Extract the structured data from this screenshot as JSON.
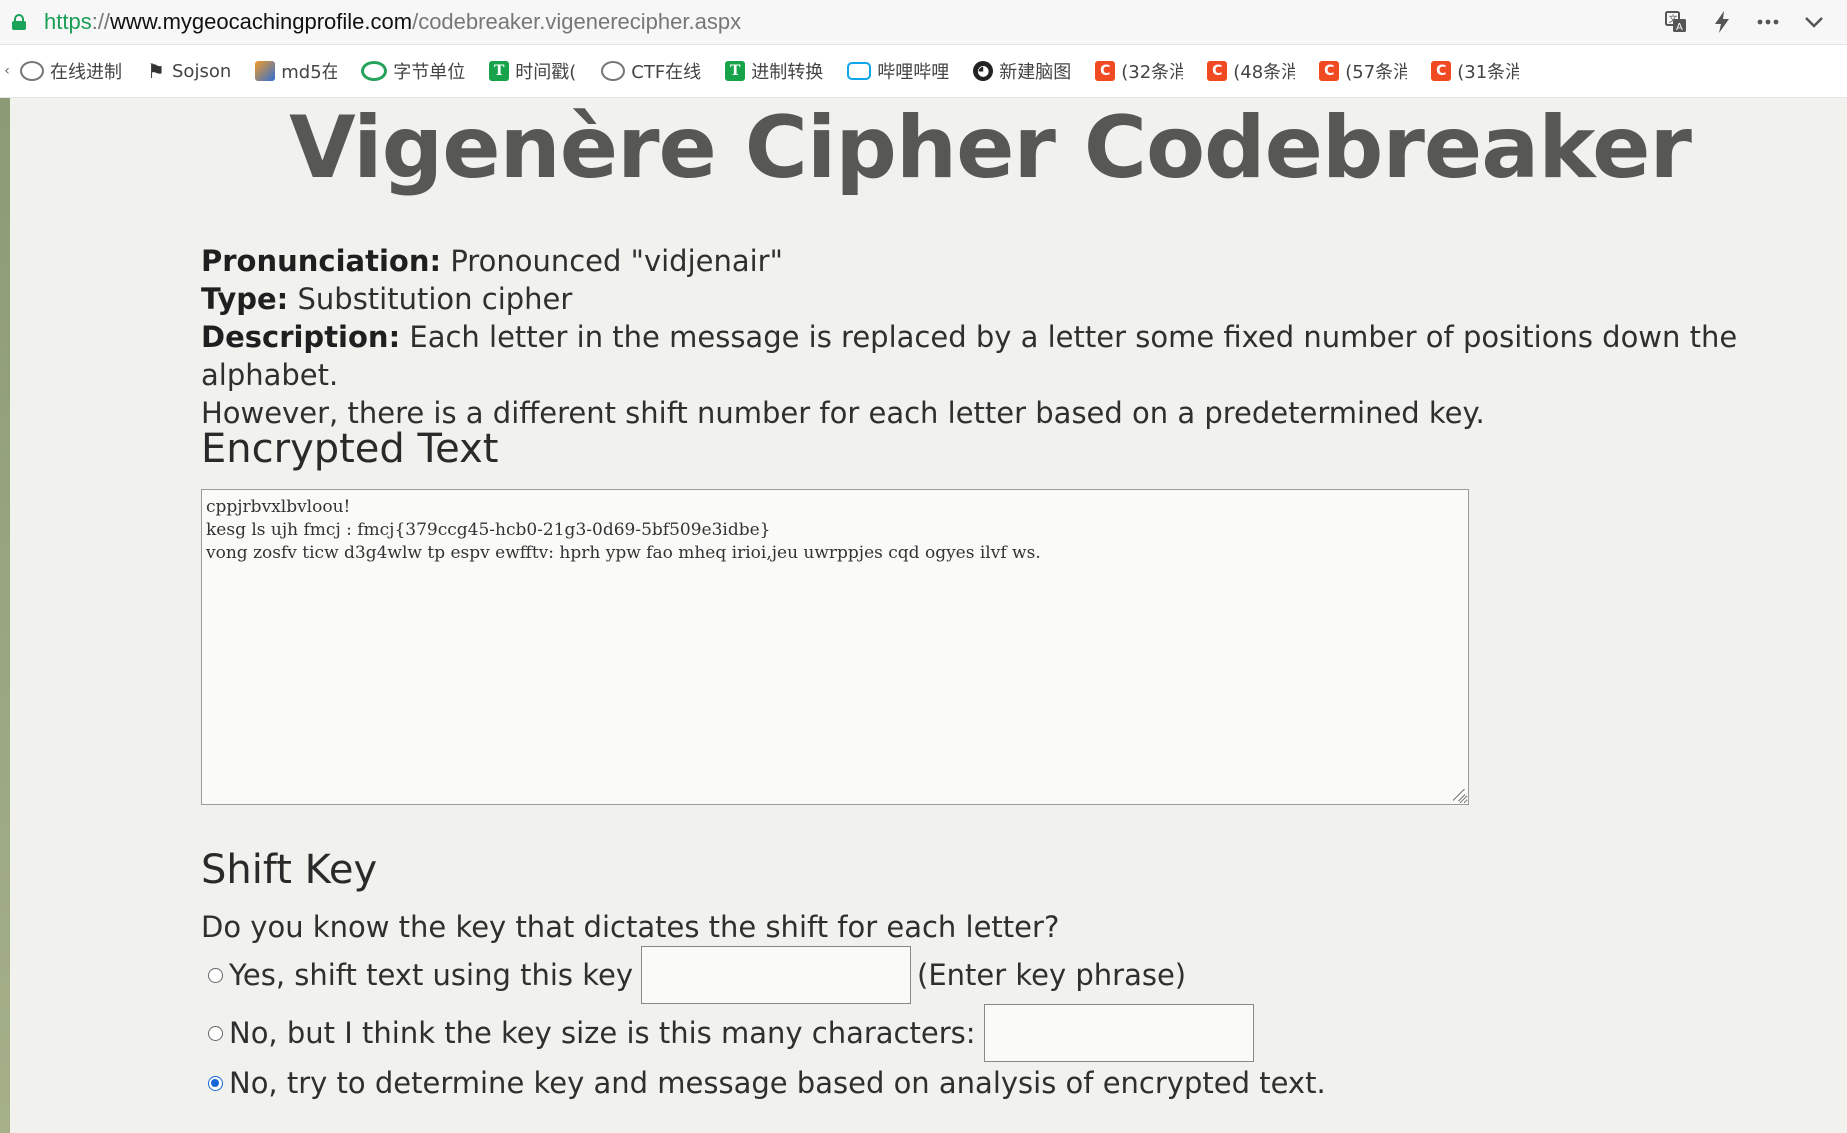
{
  "address_bar": {
    "scheme": "https",
    "separator": "://",
    "host": "www.mygeocachingprofile.com",
    "path": "/codebreaker.vigenerecipher.aspx",
    "icons": [
      "translate-icon",
      "lightning-icon",
      "more-icon",
      "chevron-down-icon"
    ]
  },
  "bookmarks": [
    {
      "label": "在线进制",
      "icon": "globe-icon"
    },
    {
      "label": "Sojson",
      "icon": "flag-icon"
    },
    {
      "label": "md5在",
      "icon": "md5-icon"
    },
    {
      "label": "字节单位",
      "icon": "circle-icon"
    },
    {
      "label": "时间戳(",
      "icon": "t-icon"
    },
    {
      "label": "CTF在线",
      "icon": "globe-icon"
    },
    {
      "label": "进制转换",
      "icon": "t-icon"
    },
    {
      "label": "哔哩哔哩",
      "icon": "bilibili-icon"
    },
    {
      "label": "新建脑图",
      "icon": "owl-icon"
    },
    {
      "label": "(32条消",
      "icon": "c-icon"
    },
    {
      "label": "(48条消",
      "icon": "c-icon"
    },
    {
      "label": "(57条消",
      "icon": "c-icon"
    },
    {
      "label": "(31条消",
      "icon": "c-icon"
    }
  ],
  "page": {
    "title": "Vigenère Cipher Codebreaker",
    "pronunciation_label": "Pronunciation:",
    "pronunciation_value": "Pronounced \"vidjenair\"",
    "type_label": "Type:",
    "type_value": "Substitution cipher",
    "description_label": "Description:",
    "description_line1": "Each letter in the message is replaced by a letter some fixed number of positions down the alphabet.",
    "description_line2": "However, there is a different shift number for each letter based on a predetermined key.",
    "encrypted_heading": "Encrypted Text",
    "encrypted_text": "cppjrbvxlbvloou!\nkesg ls ujh fmcj : fmcj{379ccg45-hcb0-21g3-0d69-5bf509e3idbe}\nvong zosfv ticw d3g4wlw tp espv ewfftv: hprh ypw fao mheq irioi,jeu uwrppjes cqd ogyes ilvf ws.",
    "shift_heading": "Shift Key",
    "shift_question": "Do you know the key that dictates the shift for each letter?",
    "option1_label": "Yes, shift text using this key",
    "option1_hint": "(Enter key phrase)",
    "option1_value": "",
    "option2_label": "No, but I think the key size is this many characters:",
    "option2_value": "",
    "option3_label": "No, try to determine key and message based on analysis of encrypted text.",
    "selected_option": 3
  },
  "colors": {
    "secure_green": "#1aa35b",
    "title_gray": "#575754",
    "radio_blue": "#1266d6",
    "page_bg": "#f1f1ee"
  }
}
